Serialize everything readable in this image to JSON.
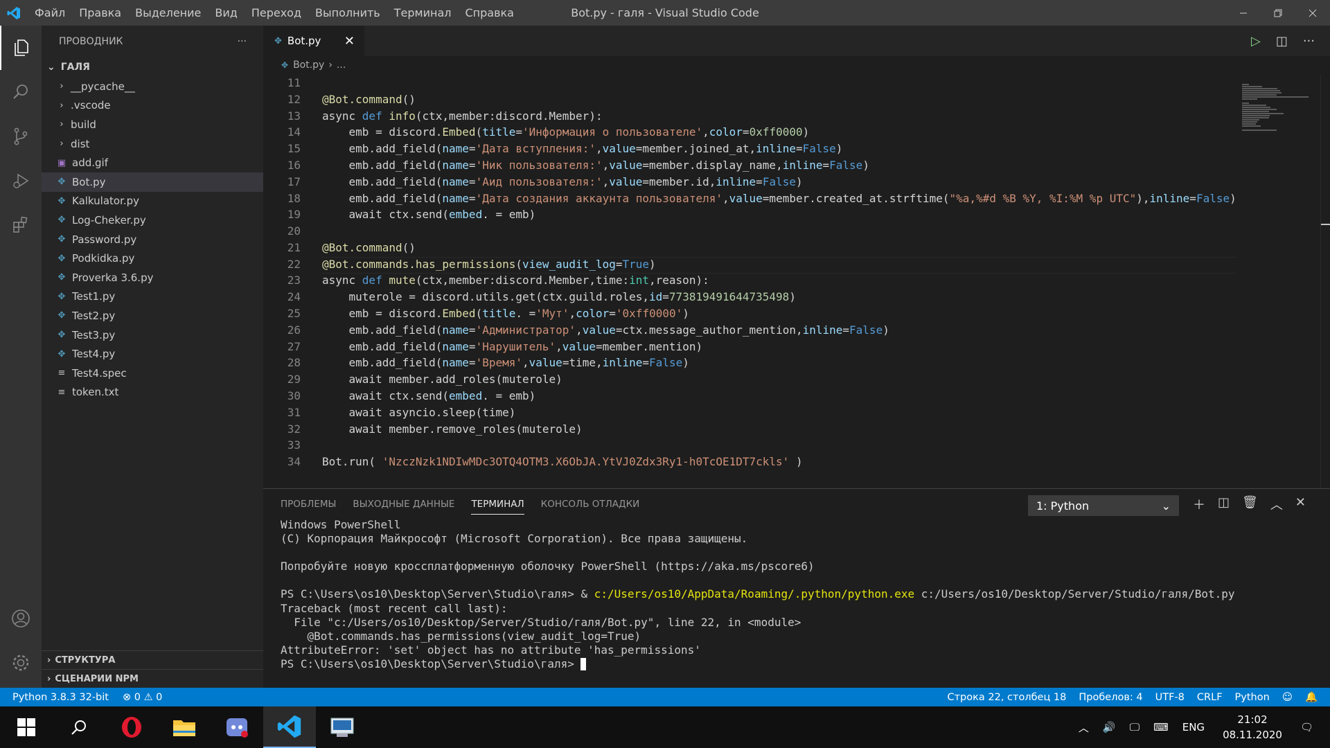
{
  "window": {
    "title": "Bot.py - галя - Visual Studio Code",
    "menu": [
      "Файл",
      "Правка",
      "Выделение",
      "Вид",
      "Переход",
      "Выполнить",
      "Терминал",
      "Справка"
    ]
  },
  "sidebar": {
    "header": "ПРОВОДНИК",
    "more": "···",
    "folder": "ГАЛЯ",
    "items": [
      {
        "label": "__pycache__",
        "kind": "folder"
      },
      {
        "label": ".vscode",
        "kind": "folder"
      },
      {
        "label": "build",
        "kind": "folder"
      },
      {
        "label": "dist",
        "kind": "folder"
      },
      {
        "label": "add.gif",
        "kind": "gif"
      },
      {
        "label": "Bot.py",
        "kind": "py"
      },
      {
        "label": "Kalkulator.py",
        "kind": "py"
      },
      {
        "label": "Log-Cheker.py",
        "kind": "py"
      },
      {
        "label": "Password.py",
        "kind": "py"
      },
      {
        "label": "Podkidka.py",
        "kind": "py"
      },
      {
        "label": "Proverka 3.6.py",
        "kind": "py"
      },
      {
        "label": "Test1.py",
        "kind": "py"
      },
      {
        "label": "Test2.py",
        "kind": "py"
      },
      {
        "label": "Test3.py",
        "kind": "py"
      },
      {
        "label": "Test4.py",
        "kind": "py"
      },
      {
        "label": "Test4.spec",
        "kind": "txt"
      },
      {
        "label": "token.txt",
        "kind": "txt"
      }
    ],
    "sections": [
      "СТРУКТУРА",
      "СЦЕНАРИИ NPM"
    ]
  },
  "editor": {
    "tab": "Bot.py",
    "breadcrumb_file": "Bot.py",
    "breadcrumb_more": "...",
    "lines": [
      {
        "n": "11",
        "t": []
      },
      {
        "n": "12",
        "t": [
          [
            "fn",
            "@Bot.command"
          ],
          [
            "",
            "()"
          ]
        ]
      },
      {
        "n": "13",
        "t": [
          [
            "",
            "async "
          ],
          [
            "kw",
            "def "
          ],
          [
            "fn",
            "info"
          ],
          [
            "",
            "(ctx,member:discord.Member):"
          ]
        ]
      },
      {
        "n": "14",
        "t": [
          [
            "",
            "    emb = discord."
          ],
          [
            "fn",
            "Embed"
          ],
          [
            "",
            "("
          ],
          [
            "prm",
            "title"
          ],
          [
            "",
            "="
          ],
          [
            "str",
            "'Информация о пользователе'"
          ],
          [
            "",
            ","
          ],
          [
            "prm",
            "color"
          ],
          [
            "",
            "="
          ],
          [
            "num",
            "0xff0000"
          ],
          [
            "",
            ")"
          ]
        ]
      },
      {
        "n": "15",
        "t": [
          [
            "",
            "    emb.add_field("
          ],
          [
            "prm",
            "name"
          ],
          [
            "",
            "="
          ],
          [
            "str",
            "'Дата вступления:'"
          ],
          [
            "",
            ","
          ],
          [
            "prm",
            "value"
          ],
          [
            "",
            "=member.joined_at,"
          ],
          [
            "prm",
            "inline"
          ],
          [
            "",
            "="
          ],
          [
            "kw",
            "False"
          ],
          [
            "",
            ")"
          ]
        ]
      },
      {
        "n": "16",
        "t": [
          [
            "",
            "    emb.add_field("
          ],
          [
            "prm",
            "name"
          ],
          [
            "",
            "="
          ],
          [
            "str",
            "'Ник пользователя:'"
          ],
          [
            "",
            ","
          ],
          [
            "prm",
            "value"
          ],
          [
            "",
            "=member.display_name,"
          ],
          [
            "prm",
            "inline"
          ],
          [
            "",
            "="
          ],
          [
            "kw",
            "False"
          ],
          [
            "",
            ")"
          ]
        ]
      },
      {
        "n": "17",
        "t": [
          [
            "",
            "    emb.add_field("
          ],
          [
            "prm",
            "name"
          ],
          [
            "",
            "="
          ],
          [
            "str",
            "'Аид пользователя:'"
          ],
          [
            "",
            ","
          ],
          [
            "prm",
            "value"
          ],
          [
            "",
            "=member.id,"
          ],
          [
            "prm",
            "inline"
          ],
          [
            "",
            "="
          ],
          [
            "kw",
            "False"
          ],
          [
            "",
            ")"
          ]
        ]
      },
      {
        "n": "18",
        "t": [
          [
            "",
            "    emb.add_field("
          ],
          [
            "prm",
            "name"
          ],
          [
            "",
            "="
          ],
          [
            "str",
            "'Дата создания аккаунта пользователя'"
          ],
          [
            "",
            ","
          ],
          [
            "prm",
            "value"
          ],
          [
            "",
            "=member.created_at.strftime("
          ],
          [
            "str",
            "\"%a,%#d %B %Y, %I:%M %p UTC\""
          ],
          [
            "",
            "),"
          ],
          [
            "prm",
            "inline"
          ],
          [
            "",
            "="
          ],
          [
            "kw",
            "False"
          ],
          [
            "",
            ")"
          ]
        ]
      },
      {
        "n": "19",
        "t": [
          [
            "",
            "    await ctx.send("
          ],
          [
            "prm",
            "embed"
          ],
          [
            "",
            ". = emb)"
          ]
        ]
      },
      {
        "n": "20",
        "t": []
      },
      {
        "n": "21",
        "t": [
          [
            "fn",
            "@Bot.command"
          ],
          [
            "",
            "()"
          ]
        ]
      },
      {
        "n": "22",
        "t": [
          [
            "fn",
            "@Bot.commands.has_permissions"
          ],
          [
            "",
            "("
          ],
          [
            "prm",
            "view_audit_log"
          ],
          [
            "",
            "="
          ],
          [
            "kw",
            "True"
          ],
          [
            "",
            ")"
          ]
        ]
      },
      {
        "n": "23",
        "t": [
          [
            "",
            "async "
          ],
          [
            "kw",
            "def "
          ],
          [
            "fn",
            "mute"
          ],
          [
            "",
            "(ctx,member:discord.Member,time:"
          ],
          [
            "typ",
            "int"
          ],
          [
            "",
            ",reason):"
          ]
        ]
      },
      {
        "n": "24",
        "t": [
          [
            "",
            "    muterole = discord.utils.get(ctx.guild.roles,"
          ],
          [
            "prm",
            "id"
          ],
          [
            "",
            "="
          ],
          [
            "num",
            "773819491644735498"
          ],
          [
            "",
            ")"
          ]
        ]
      },
      {
        "n": "25",
        "t": [
          [
            "",
            "    emb = discord."
          ],
          [
            "fn",
            "Embed"
          ],
          [
            "",
            "("
          ],
          [
            "prm",
            "title"
          ],
          [
            "",
            ". ="
          ],
          [
            "str",
            "'Мут'"
          ],
          [
            "",
            ","
          ],
          [
            "prm",
            "color"
          ],
          [
            "",
            "="
          ],
          [
            "str",
            "'0xff0000'"
          ],
          [
            "",
            ")"
          ]
        ]
      },
      {
        "n": "26",
        "t": [
          [
            "",
            "    emb.add_field("
          ],
          [
            "prm",
            "name"
          ],
          [
            "",
            "="
          ],
          [
            "str",
            "'Администратор'"
          ],
          [
            "",
            ","
          ],
          [
            "prm",
            "value"
          ],
          [
            "",
            "=ctx.message_author_mention,"
          ],
          [
            "prm",
            "inline"
          ],
          [
            "",
            "="
          ],
          [
            "kw",
            "False"
          ],
          [
            "",
            ")"
          ]
        ]
      },
      {
        "n": "27",
        "t": [
          [
            "",
            "    emb.add_field("
          ],
          [
            "prm",
            "name"
          ],
          [
            "",
            "="
          ],
          [
            "str",
            "'Нарушитель'"
          ],
          [
            "",
            ","
          ],
          [
            "prm",
            "value"
          ],
          [
            "",
            "=member.mention)"
          ]
        ]
      },
      {
        "n": "28",
        "t": [
          [
            "",
            "    emb.add_field("
          ],
          [
            "prm",
            "name"
          ],
          [
            "",
            "="
          ],
          [
            "str",
            "'Время'"
          ],
          [
            "",
            ","
          ],
          [
            "prm",
            "value"
          ],
          [
            "",
            "=time,"
          ],
          [
            "prm",
            "inline"
          ],
          [
            "",
            "="
          ],
          [
            "kw",
            "False"
          ],
          [
            "",
            ")"
          ]
        ]
      },
      {
        "n": "29",
        "t": [
          [
            "",
            "    await member.add_roles(muterole)"
          ]
        ]
      },
      {
        "n": "30",
        "t": [
          [
            "",
            "    await ctx.send("
          ],
          [
            "prm",
            "embed"
          ],
          [
            "",
            ". = emb)"
          ]
        ]
      },
      {
        "n": "31",
        "t": [
          [
            "",
            "    await asyncio.sleep(time)"
          ]
        ]
      },
      {
        "n": "32",
        "t": [
          [
            "",
            "    await member.remove_roles(muterole)"
          ]
        ]
      },
      {
        "n": "33",
        "t": []
      },
      {
        "n": "34",
        "t": [
          [
            "",
            "Bot.run( "
          ],
          [
            "str",
            "'NzczNzk1NDIwMDc3OTQ4OTM3.X6ObJA.YtVJ0Zdx3Ry1-h0TcOE1DT7ckls'"
          ],
          [
            "",
            " )"
          ]
        ]
      }
    ]
  },
  "panel": {
    "tabs": [
      "ПРОБЛЕМЫ",
      "ВЫХОДНЫЕ ДАННЫЕ",
      "ТЕРМИНАЛ",
      "КОНСОЛЬ ОТЛАДКИ"
    ],
    "terminal_select": "1: Python",
    "terminal_lines": [
      "Windows PowerShell",
      "(C) Корпорация Майкрософт (Microsoft Corporation). Все права защищены.",
      "",
      "Попробуйте новую кроссплатформенную оболочку PowerShell (https://aka.ms/pscore6)",
      "",
      "",
      "Traceback (most recent call last):",
      "  File \"c:/Users/os10/Desktop/Server/Studio/галя/Bot.py\", line 22, in <module>",
      "    @Bot.commands.has_permissions(view_audit_log=True)",
      "AttributeError: 'set' object has no attribute 'has_permissions'",
      ""
    ],
    "cmd_prompt": "PS C:\\Users\\os10\\Desktop\\Server\\Studio\\галя> & ",
    "cmd_exe": "c:/Users/os10/AppData/Roaming/.python/python.exe",
    "cmd_arg": " c:/Users/os10/Desktop/Server/Studio/галя/Bot.py",
    "final_prompt": "PS C:\\Users\\os10\\Desktop\\Server\\Studio\\галя> "
  },
  "statusbar": {
    "python": "Python 3.8.3 32-bit",
    "errors": "⊗ 0 ⚠ 0",
    "position": "Строка 22, столбец 18",
    "spaces": "Пробелов: 4",
    "encoding": "UTF-8",
    "eol": "CRLF",
    "language": "Python"
  },
  "taskbar": {
    "lang": "ENG",
    "time": "21:02",
    "date": "08.11.2020"
  }
}
